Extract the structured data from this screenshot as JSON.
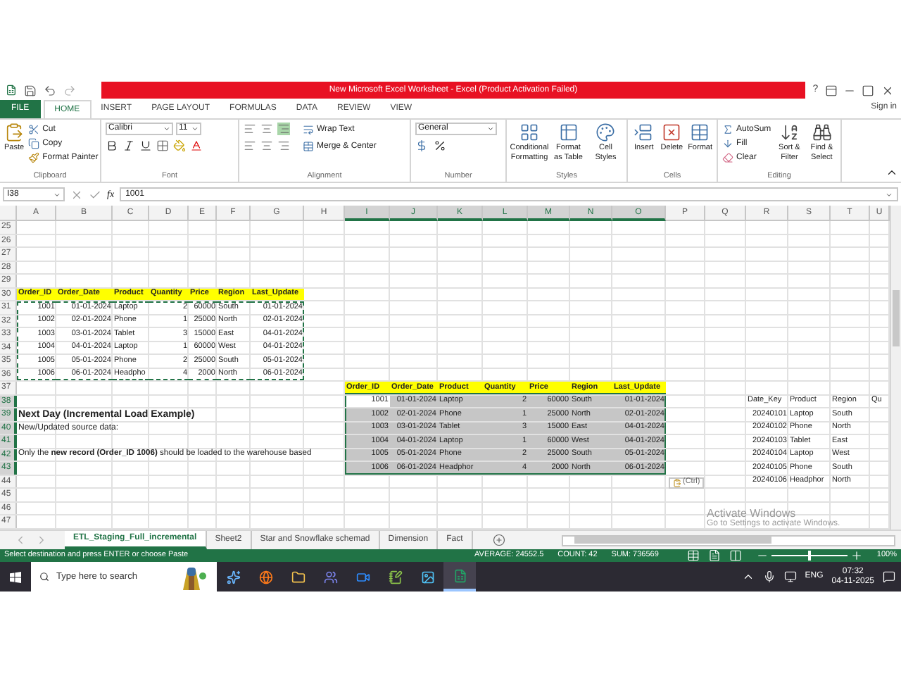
{
  "title_bar": {
    "title": "New Microsoft Excel Worksheet - Excel (Product Activation Failed)",
    "help": "?"
  },
  "ribbon": {
    "tabs": [
      {
        "label": "FILE",
        "kind": "file",
        "selected": false
      },
      {
        "label": "HOME",
        "kind": "tab",
        "selected": true
      },
      {
        "label": "INSERT",
        "kind": "tab",
        "selected": false
      },
      {
        "label": "PAGE LAYOUT",
        "kind": "tab",
        "selected": false
      },
      {
        "label": "FORMULAS",
        "kind": "tab",
        "selected": false
      },
      {
        "label": "DATA",
        "kind": "tab",
        "selected": false
      },
      {
        "label": "REVIEW",
        "kind": "tab",
        "selected": false
      },
      {
        "label": "VIEW",
        "kind": "tab",
        "selected": false
      }
    ],
    "sign_in": "Sign in",
    "clipboard": {
      "label": "Clipboard",
      "paste": "Paste",
      "cut": "Cut",
      "copy": "Copy",
      "format_painter": "Format Painter"
    },
    "font": {
      "label": "Font",
      "name": "Calibri",
      "size": "11"
    },
    "alignment": {
      "label": "Alignment",
      "wrap": "Wrap Text",
      "merge": "Merge & Center"
    },
    "number": {
      "label": "Number",
      "format": "General"
    },
    "styles": {
      "label": "Styles",
      "items": [
        "Conditional Formatting",
        "Format as Table",
        "Cell Styles"
      ]
    },
    "cells": {
      "label": "Cells",
      "items": [
        "Insert",
        "Delete",
        "Format"
      ]
    },
    "editing": {
      "label": "Editing",
      "small": [
        "AutoSum",
        "Fill",
        "Clear"
      ],
      "big": [
        "Sort & Filter",
        "Find & Select"
      ]
    }
  },
  "formula_bar": {
    "name_box": "I38",
    "fx": "fx",
    "value": "1001"
  },
  "sheet": {
    "columns": [
      {
        "label": "A",
        "selected": false
      },
      {
        "label": "B",
        "selected": false
      },
      {
        "label": "C",
        "selected": false
      },
      {
        "label": "D",
        "selected": false
      },
      {
        "label": "E",
        "selected": false
      },
      {
        "label": "F",
        "selected": false
      },
      {
        "label": "G",
        "selected": false
      },
      {
        "label": "H",
        "selected": false
      },
      {
        "label": "I",
        "selected": true
      },
      {
        "label": "J",
        "selected": true
      },
      {
        "label": "K",
        "selected": true
      },
      {
        "label": "L",
        "selected": true
      },
      {
        "label": "M",
        "selected": true
      },
      {
        "label": "N",
        "selected": true
      },
      {
        "label": "O",
        "selected": true
      },
      {
        "label": "P",
        "selected": false
      },
      {
        "label": "Q",
        "selected": false
      },
      {
        "label": "R",
        "selected": false
      },
      {
        "label": "S",
        "selected": false
      },
      {
        "label": "T",
        "selected": false
      },
      {
        "label": "U",
        "selected": false
      }
    ],
    "rows": [
      {
        "label": "25",
        "selected": false
      },
      {
        "label": "26",
        "selected": false
      },
      {
        "label": "27",
        "selected": false
      },
      {
        "label": "28",
        "selected": false
      },
      {
        "label": "29",
        "selected": false
      },
      {
        "label": "30",
        "selected": false
      },
      {
        "label": "31",
        "selected": false
      },
      {
        "label": "32",
        "selected": false
      },
      {
        "label": "33",
        "selected": false
      },
      {
        "label": "34",
        "selected": false
      },
      {
        "label": "35",
        "selected": false
      },
      {
        "label": "36",
        "selected": false
      },
      {
        "label": "37",
        "selected": false
      },
      {
        "label": "38",
        "selected": true
      },
      {
        "label": "39",
        "selected": true
      },
      {
        "label": "40",
        "selected": true
      },
      {
        "label": "41",
        "selected": true
      },
      {
        "label": "42",
        "selected": true
      },
      {
        "label": "43",
        "selected": true
      },
      {
        "label": "44",
        "selected": false
      },
      {
        "label": "45",
        "selected": false
      },
      {
        "label": "46",
        "selected": false
      },
      {
        "label": "47",
        "selected": false
      }
    ],
    "source_table": {
      "copied": true,
      "columns": [
        {
          "label": "Order_ID",
          "kind": "number"
        },
        {
          "label": "Order_Date",
          "kind": "number"
        },
        {
          "label": "Product",
          "kind": "text"
        },
        {
          "label": "Quantity",
          "kind": "number"
        },
        {
          "label": "Price",
          "kind": "number"
        },
        {
          "label": "Region",
          "kind": "text"
        },
        {
          "label": "Last_Update",
          "kind": "number"
        }
      ],
      "rows": [
        [
          "1001",
          "01-01-2024",
          "Laptop",
          "2",
          "60000",
          "South",
          "01-01-2024"
        ],
        [
          "1002",
          "02-01-2024",
          "Phone",
          "1",
          "25000",
          "North",
          "02-01-2024"
        ],
        [
          "1003",
          "03-01-2024",
          "Tablet",
          "3",
          "15000",
          "East",
          "04-01-2024"
        ],
        [
          "1004",
          "04-01-2024",
          "Laptop",
          "1",
          "60000",
          "West",
          "04-01-2024"
        ],
        [
          "1005",
          "05-01-2024",
          "Phone",
          "2",
          "25000",
          "South",
          "05-01-2024"
        ],
        [
          "1006",
          "06-01-2024",
          "Headpho",
          "4",
          "2000",
          "North",
          "06-01-2024"
        ]
      ]
    },
    "heading": "Next Day (Incremental Load Example)",
    "subheading": "New/Updated source data:",
    "note": "Only the **new record (Order_ID 1006)** should be loaded to the warehouse based",
    "pasted_table": {
      "selected": true,
      "columns": [
        {
          "label": "Order_ID",
          "kind": "number"
        },
        {
          "label": "Order_Date",
          "kind": "number"
        },
        {
          "label": "Product",
          "kind": "text"
        },
        {
          "label": "Quantity",
          "kind": "number"
        },
        {
          "label": "Price",
          "kind": "number"
        },
        {
          "label": "Region",
          "kind": "text"
        },
        {
          "label": "Last_Update",
          "kind": "number"
        }
      ],
      "rows": [
        [
          "1001",
          "01-01-2024",
          "Laptop",
          "2",
          "60000",
          "South",
          "01-01-2024"
        ],
        [
          "1002",
          "02-01-2024",
          "Phone",
          "1",
          "25000",
          "North",
          "02-01-2024"
        ],
        [
          "1003",
          "03-01-2024",
          "Tablet",
          "3",
          "15000",
          "East",
          "04-01-2024"
        ],
        [
          "1004",
          "04-01-2024",
          "Laptop",
          "1",
          "60000",
          "West",
          "04-01-2024"
        ],
        [
          "1005",
          "05-01-2024",
          "Phone",
          "2",
          "25000",
          "South",
          "05-01-2024"
        ],
        [
          "1006",
          "06-01-2024",
          "Headphor",
          "4",
          "2000",
          "North",
          "06-01-2024"
        ]
      ]
    },
    "dimension_table": {
      "columns": [
        {
          "label": "Date_Key",
          "kind": "number"
        },
        {
          "label": "Product",
          "kind": "text"
        },
        {
          "label": "Region",
          "kind": "text"
        },
        {
          "label": "Qu"
        }
      ],
      "rows": [
        [
          "20240101",
          "Laptop",
          "South"
        ],
        [
          "20240102",
          "Phone",
          "North"
        ],
        [
          "20240103",
          "Tablet",
          "East"
        ],
        [
          "20240104",
          "Laptop",
          "West"
        ],
        [
          "20240105",
          "Phone",
          "South"
        ],
        [
          "20240106",
          "Headphor",
          "North"
        ]
      ]
    },
    "paste_options": "(Ctrl)",
    "activation": {
      "title": "Activate Windows",
      "hint": "Go to Settings to activate Windows."
    }
  },
  "sheet_tabs": [
    {
      "label": "ETL_Staging_Full_incremental",
      "selected": true
    },
    {
      "label": "Sheet2",
      "selected": false
    },
    {
      "label": "Star and Snowflake schemad",
      "selected": false
    },
    {
      "label": "Dimension",
      "selected": false
    },
    {
      "label": "Fact",
      "selected": false
    }
  ],
  "status_bar": {
    "message": "Select destination and press ENTER or choose Paste",
    "average": "AVERAGE: 24552.5",
    "count": "COUNT: 42",
    "sum": "SUM: 736569",
    "zoom": {
      "level": 0.5,
      "reading": "100%"
    }
  },
  "taskbar": {
    "search": "Type here to search",
    "apps": [
      {
        "kind": "copilot",
        "active": false
      },
      {
        "kind": "browser",
        "active": false
      },
      {
        "kind": "folder",
        "active": false
      },
      {
        "kind": "teams",
        "active": false
      },
      {
        "kind": "video",
        "active": false
      },
      {
        "kind": "notes",
        "active": false
      },
      {
        "kind": "photos",
        "active": false
      },
      {
        "kind": "excel",
        "active": true
      }
    ],
    "language": "ENG",
    "time": "07:32",
    "date": "04-11-2025"
  }
}
